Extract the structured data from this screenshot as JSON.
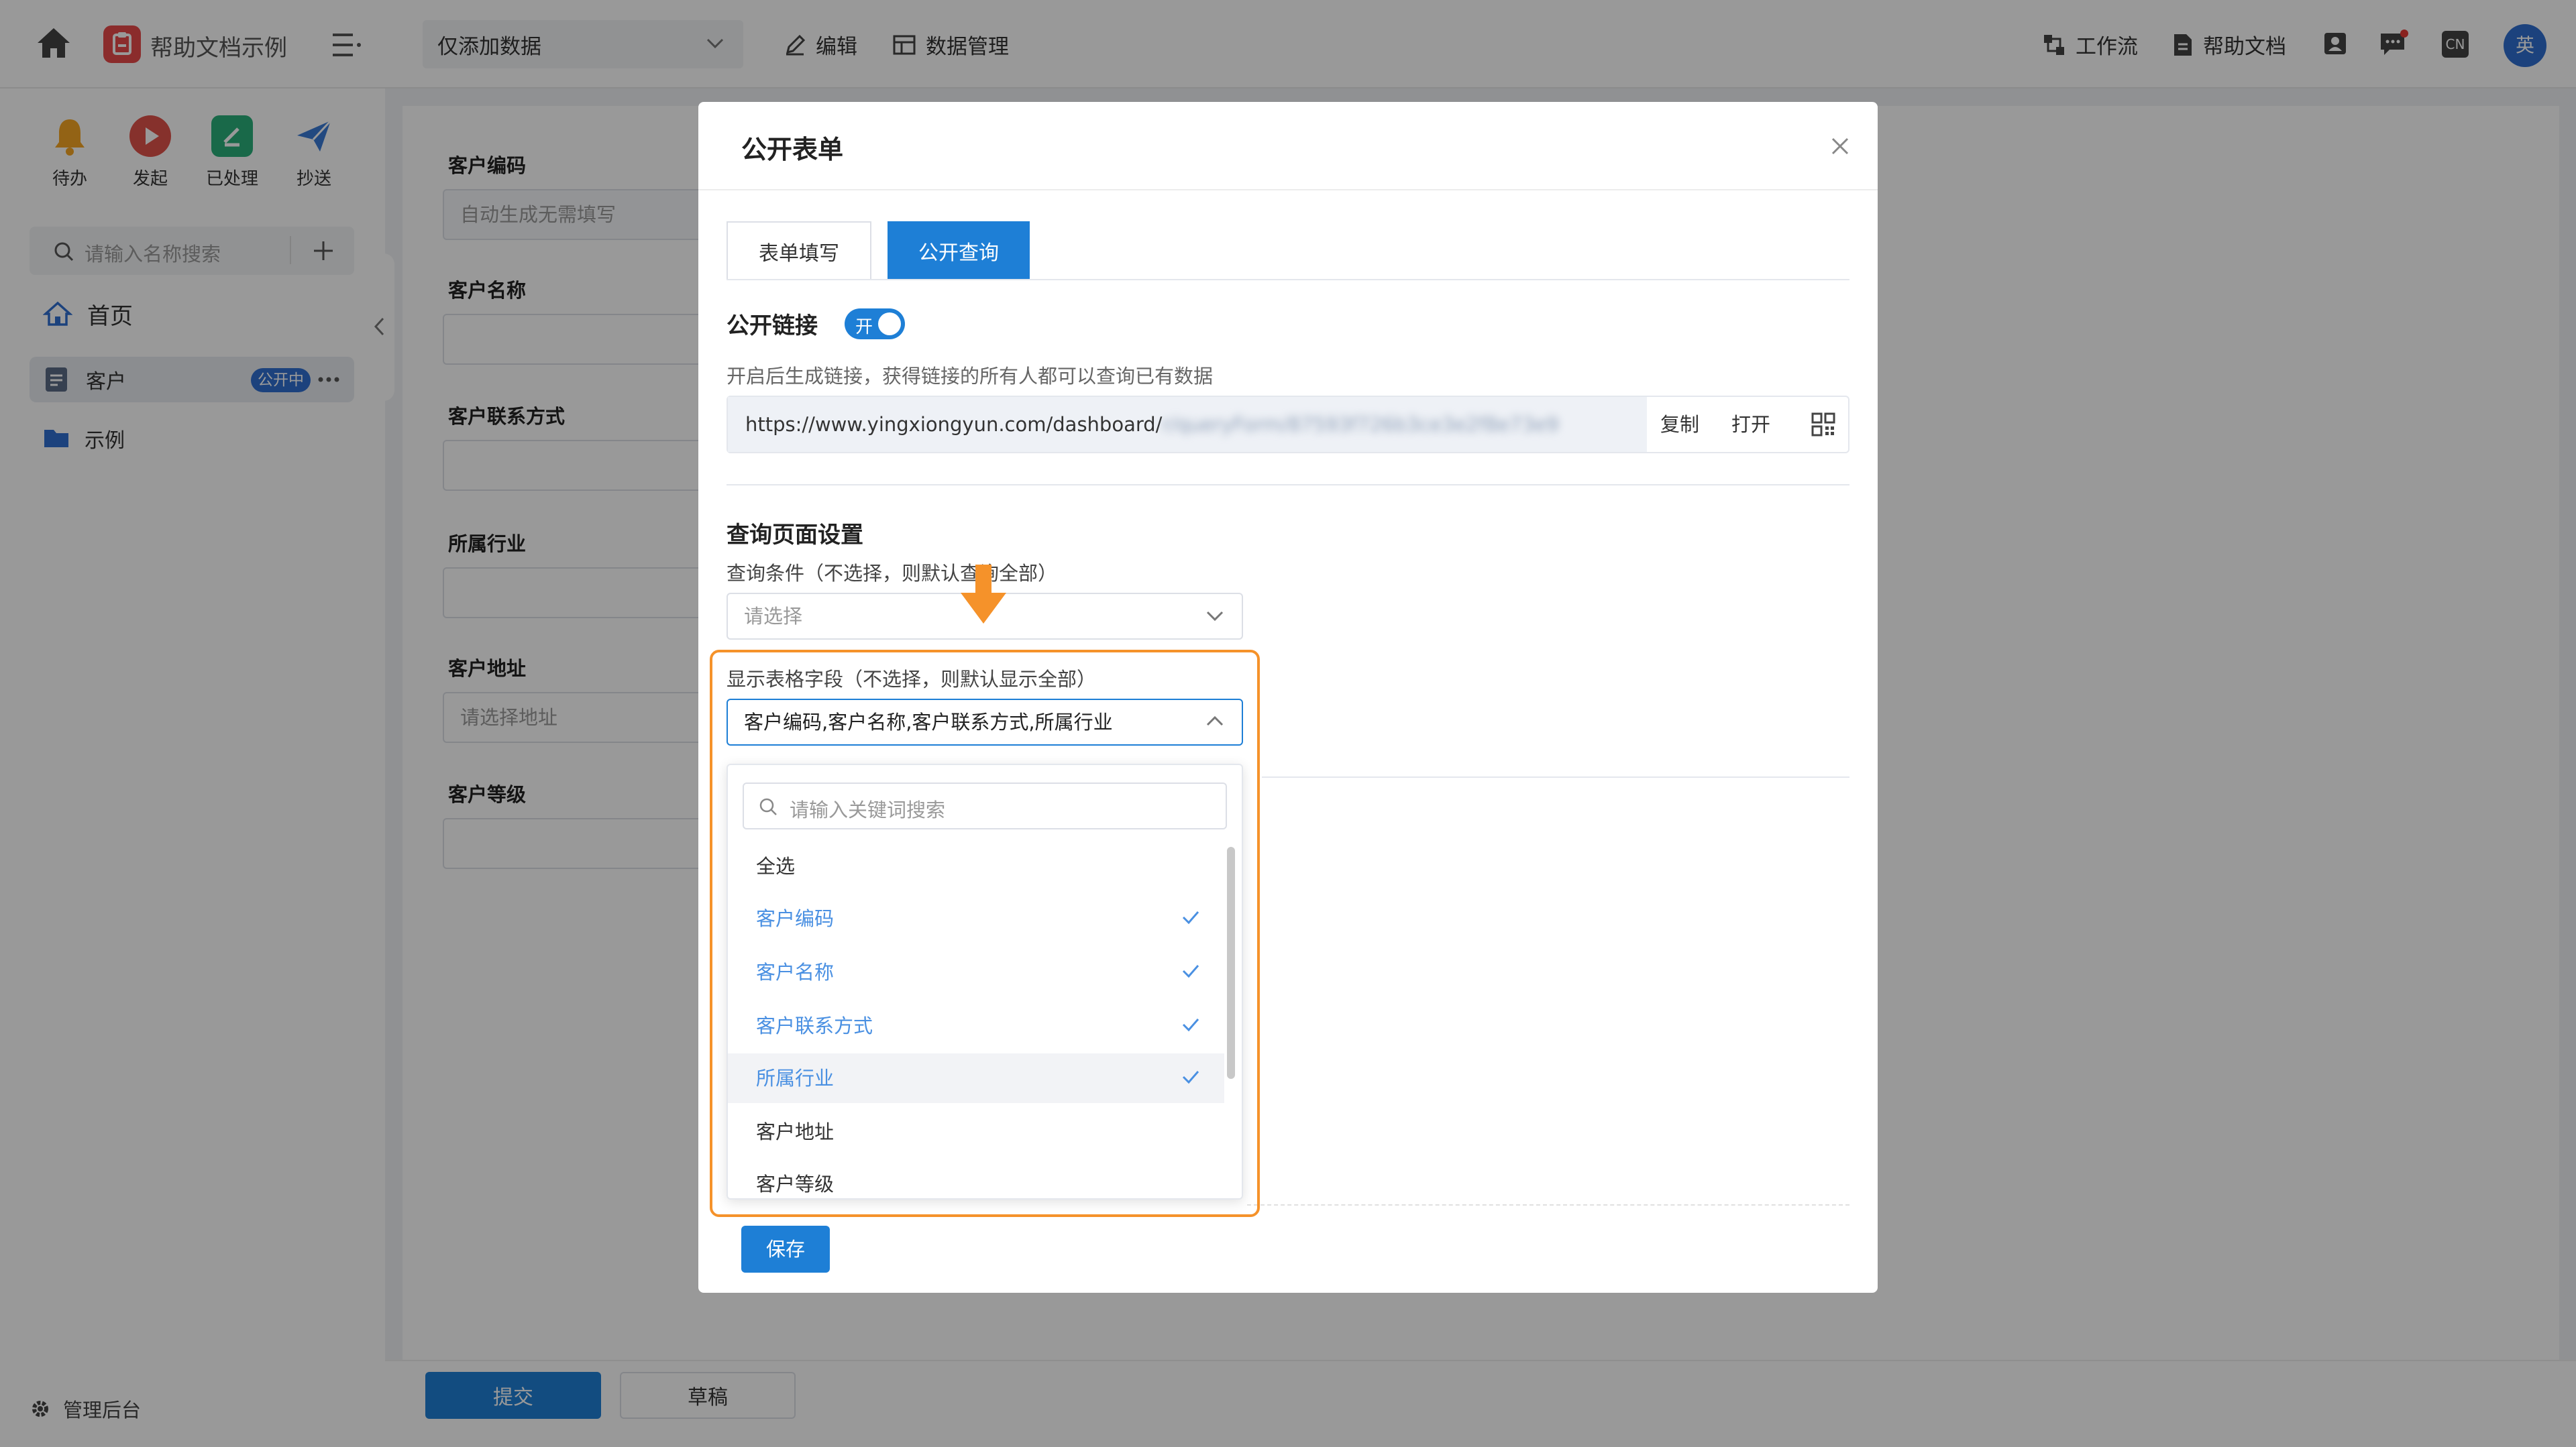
{
  "app": {
    "title": "帮助文档示例",
    "scope_select": "仅添加数据",
    "actions": [
      "编辑",
      "数据管理"
    ],
    "right_actions": [
      "工作流",
      "帮助文档"
    ],
    "lang_badge": "CN",
    "avatar_text": "英"
  },
  "sidebar": {
    "quick": [
      "待办",
      "发起",
      "已处理",
      "抄送"
    ],
    "search_placeholder": "请输入名称搜索",
    "home": "首页",
    "items": [
      {
        "label": "客户",
        "badge": "公开中"
      },
      {
        "label": "示例"
      }
    ],
    "admin": "管理后台"
  },
  "form": {
    "fields": [
      {
        "label": "客户编码",
        "placeholder": "自动生成无需填写"
      },
      {
        "label": "客户名称",
        "placeholder": ""
      },
      {
        "label": "客户联系方式",
        "placeholder": ""
      },
      {
        "label": "所属行业",
        "placeholder": ""
      },
      {
        "label": "客户地址",
        "placeholder": "请选择地址"
      },
      {
        "label": "客户等级",
        "placeholder": ""
      }
    ],
    "submit": "提交",
    "draft": "草稿"
  },
  "modal": {
    "title": "公开表单",
    "tabs": [
      "表单填写",
      "公开查询"
    ],
    "active_tab": "公开查询",
    "public_link_title": "公开链接",
    "toggle_label": "开",
    "toggle_on": true,
    "link_hint": "开启后生成链接，获得链接的所有人都可以查询已有数据",
    "link_url": "https://www.yingxiongyun.com/dashboard/",
    "link_url_blurred": "r/queryForm/87593f726b3ce3e2f8e73e9",
    "copy": "复制",
    "open": "打开",
    "query_settings_title": "查询页面设置",
    "query_conditions_label": "查询条件（不选择，则默认查询全部）",
    "query_conditions_placeholder": "请选择",
    "display_fields_label": "显示表格字段（不选择，则默认显示全部）",
    "display_fields_value": "客户编码,客户名称,客户联系方式,所属行业",
    "dropdown": {
      "search_placeholder": "请输入关键词搜索",
      "options": [
        {
          "label": "全选",
          "selected": false
        },
        {
          "label": "客户编码",
          "selected": true
        },
        {
          "label": "客户名称",
          "selected": true
        },
        {
          "label": "客户联系方式",
          "selected": true
        },
        {
          "label": "所属行业",
          "selected": true
        },
        {
          "label": "客户地址",
          "selected": false
        },
        {
          "label": "客户等级",
          "selected": false
        }
      ]
    },
    "save": "保存"
  },
  "colors": {
    "primary": "#1e7fd6",
    "highlight": "#f5922a",
    "selected_text": "#4a90e2"
  }
}
